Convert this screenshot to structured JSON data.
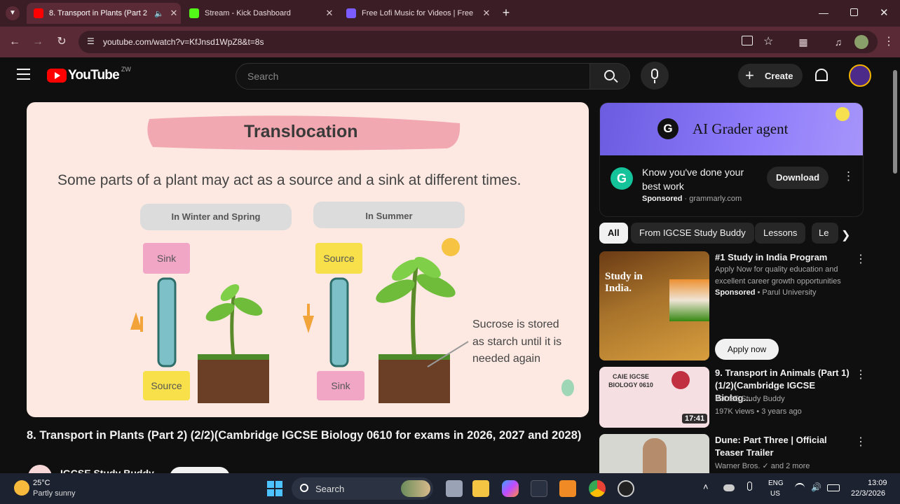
{
  "browser": {
    "tabs": [
      {
        "title": "8. Transport in Plants (Part 2",
        "active": true
      },
      {
        "title": "Stream - Kick Dashboard",
        "active": false
      },
      {
        "title": "Free Lofi Music for Videos | Free",
        "active": false
      }
    ],
    "new_tab_label": "+",
    "url": "youtube.com/watch?v=KfJnsd1WpZ8&t=8s"
  },
  "youtube": {
    "logo_text": "YouTube",
    "logo_superscript": "ZW",
    "search_placeholder": "Search",
    "create_label": "Create"
  },
  "video": {
    "slide_title": "Translocation",
    "slide_text": "Some parts of a plant may act as a source and a sink at different times.",
    "col1_header": "In Winter and Spring",
    "col2_header": "In Summer",
    "col1_top": "Sink",
    "col1_bottom": "Source",
    "col2_top": "Source",
    "col2_bottom": "Sink",
    "note": "Sucrose is stored as starch until it is needed again",
    "title": "8. Transport in Plants (Part 2) (2/2)(Cambridge IGCSE Biology 0610 for exams in 2026, 2027 and 2028)",
    "channel": "IGCSE Study Buddy"
  },
  "ad": {
    "banner": "AI Grader agent",
    "headline": "Know you've done your best work",
    "sponsored": "Sponsored",
    "domain": "grammarly.com",
    "button": "Download"
  },
  "chips": [
    "All",
    "From IGCSE Study Buddy",
    "Lessons",
    "Le"
  ],
  "recommendations": [
    {
      "title": "#1 Study in India Program",
      "line1": "Apply Now for quality education and excellent career growth opportunities",
      "sponsored": "Sponsored",
      "advertiser": "Parul University",
      "button": "Apply now",
      "thumb_text": "Study in India."
    },
    {
      "title": "9. Transport in Animals (Part 1) (1/2)(Cambridge IGCSE Biolog...",
      "channel": "IGCSE Study Buddy",
      "meta": "197K views • 3 years ago",
      "duration": "17:41",
      "thumb_text": "CAIE IGCSE BIOLOGY 0610"
    },
    {
      "title": "Dune: Part Three | Official Teaser Trailer",
      "channel": "Warner Bros. ✓ and 2 more"
    }
  ],
  "taskbar": {
    "weather_temp": "25°C",
    "weather_text": "Partly sunny",
    "search_label": "Search",
    "lang1": "ENG",
    "lang2": "US",
    "time": "13:09",
    "date": "22/3/2026"
  },
  "colors": {
    "tabbar": "#3b1d25",
    "toolbar": "#5a2a36",
    "yt_red": "#ff0000",
    "slide_bg": "#fde9e2",
    "label_pink": "#f2a6c6",
    "label_yellow": "#f7e04a",
    "ad_purple": "#8f7dfb"
  }
}
